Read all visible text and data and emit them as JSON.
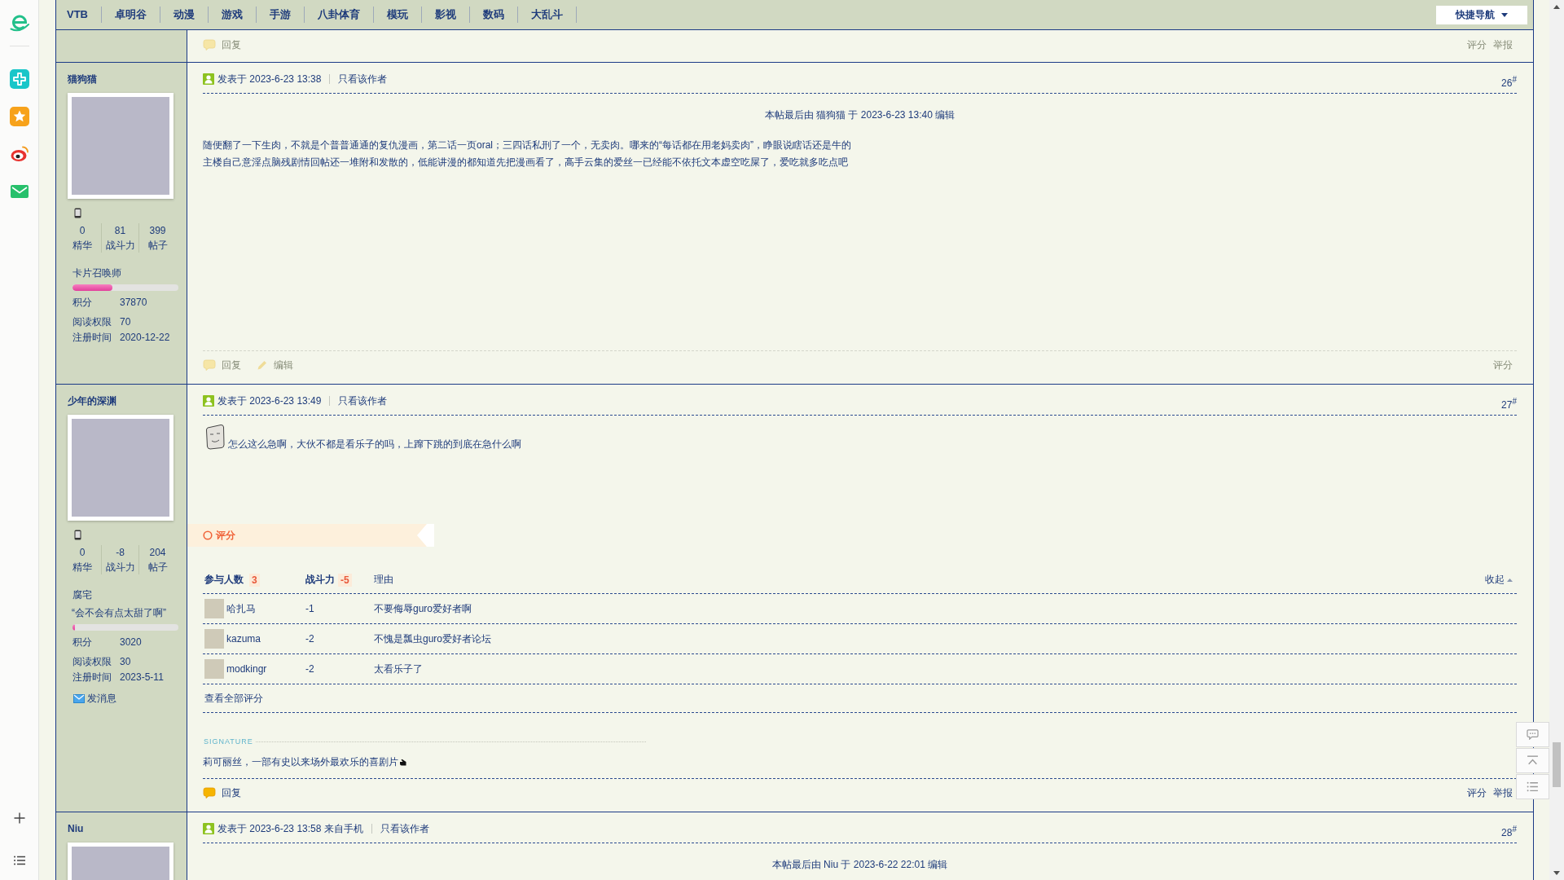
{
  "nav": {
    "items": [
      "VTB",
      "卓明谷",
      "动漫",
      "游戏",
      "手游",
      "八卦体育",
      "模玩",
      "影视",
      "数码",
      "大乱斗"
    ],
    "quick_nav": "快捷导航"
  },
  "posts": [
    {
      "footer": {
        "dimmed": true,
        "left_actions": [
          {
            "kind": "reply",
            "label": "回复"
          }
        ],
        "right_actions": [
          "评分",
          "举报"
        ]
      }
    },
    {
      "author": {
        "name": "猫狗猫",
        "mobile": true,
        "stats": [
          {
            "value": "0",
            "label": "精华"
          },
          {
            "value": "81",
            "label": "战斗力"
          },
          {
            "value": "399",
            "label": "帖子"
          }
        ],
        "rank": "卡片召唤师",
        "rank_bar": {
          "level": 0.38
        },
        "info": [
          {
            "label": "积分",
            "value": "37870"
          },
          {
            "label": "阅读权限",
            "value": "70"
          },
          {
            "label": "注册时间",
            "value": "2020-12-22"
          }
        ]
      },
      "header": {
        "posted": "发表于 2023-6-23 13:38",
        "only_author": "只看该作者",
        "floor": "26$^{#}$"
      },
      "edit_note": "本帖最后由 猫狗猫 于 2023-6-23 13:40 编辑",
      "body": [
        {
          "kind": "paragraph",
          "lines": [
            "随便翻了一下生肉，不就是个普普通通的复仇漫画，第二话一页oral；三四话私刑了一个，无卖肉。哪来的“每话都在用老妈卖肉”，睁眼说瞎话还是牛的",
            "主楼自己意淫点脑残剧情回帖还一堆附和发散的，低能讲漫的都知道先把漫画看了，高手云集的爱丝一已经能不依托文本虚空吃屎了，爱吃就多吃点吧"
          ]
        }
      ],
      "footer": {
        "dimmed": true,
        "left_actions": [
          {
            "kind": "reply",
            "label": "回复"
          },
          {
            "kind": "edit",
            "label": "编辑"
          }
        ],
        "right_actions": [
          "评分"
        ]
      }
    },
    {
      "author": {
        "name": "少年的深渊",
        "mobile": true,
        "stats": [
          {
            "value": "0",
            "label": "精华"
          },
          {
            "value": "-8",
            "label": "战斗力"
          },
          {
            "value": "204",
            "label": "帖子"
          }
        ],
        "rank": "腐宅",
        "custom_title": "“会不会有点太甜了啊”",
        "rank_bar": {
          "level": 0.02
        },
        "info": [
          {
            "label": "积分",
            "value": "3020"
          },
          {
            "label": "阅读权限",
            "value": "30"
          },
          {
            "label": "注册时间",
            "value": "2023-5-11"
          }
        ],
        "send_message": "发消息"
      },
      "header": {
        "posted": "发表于 2023-6-23 13:49",
        "only_author": "只看该作者",
        "floor": "27$^{#}$"
      },
      "body": [
        {
          "kind": "sticker"
        },
        {
          "kind": "paragraph",
          "lines": [
            "怎么这么急啊，大伙不都是看乐子的吗，上蹿下跳的到底在急什么啊"
          ]
        }
      ],
      "rating": {
        "title": "评分",
        "columns": [
          {
            "label": "参与人数",
            "count": "3"
          },
          {
            "label": "战斗力",
            "count": "-5"
          },
          {
            "label": "理由"
          }
        ],
        "collapse": "收起",
        "rows": [
          {
            "user": "哈扎马",
            "score": "-1",
            "reason": "不要侮辱guro爱好者啊"
          },
          {
            "user": "kazuma",
            "score": "-2",
            "reason": "不愧是瓢虫guro爱好者论坛"
          },
          {
            "user": "modkingr",
            "score": "-2",
            "reason": "太看乐子了"
          }
        ],
        "view_all": "查看全部评分"
      },
      "signature": {
        "label": "SIGNATURE",
        "text": "莉可丽丝，一部有史以来场外最欢乐的喜剧片"
      },
      "footer": {
        "dimmed": false,
        "left_actions": [
          {
            "kind": "reply",
            "label": "回复"
          }
        ],
        "right_actions": [
          "评分",
          "举报"
        ]
      }
    },
    {
      "author": {
        "name": "Niu"
      },
      "header": {
        "posted": "发表于 2023-6-23 13:58",
        "source": "来自手机",
        "only_author": "只看该作者",
        "floor": "28$^{#}$"
      },
      "edit_note": "本帖最后由 Niu 于 2023-6-22 22:01 编辑"
    }
  ]
}
